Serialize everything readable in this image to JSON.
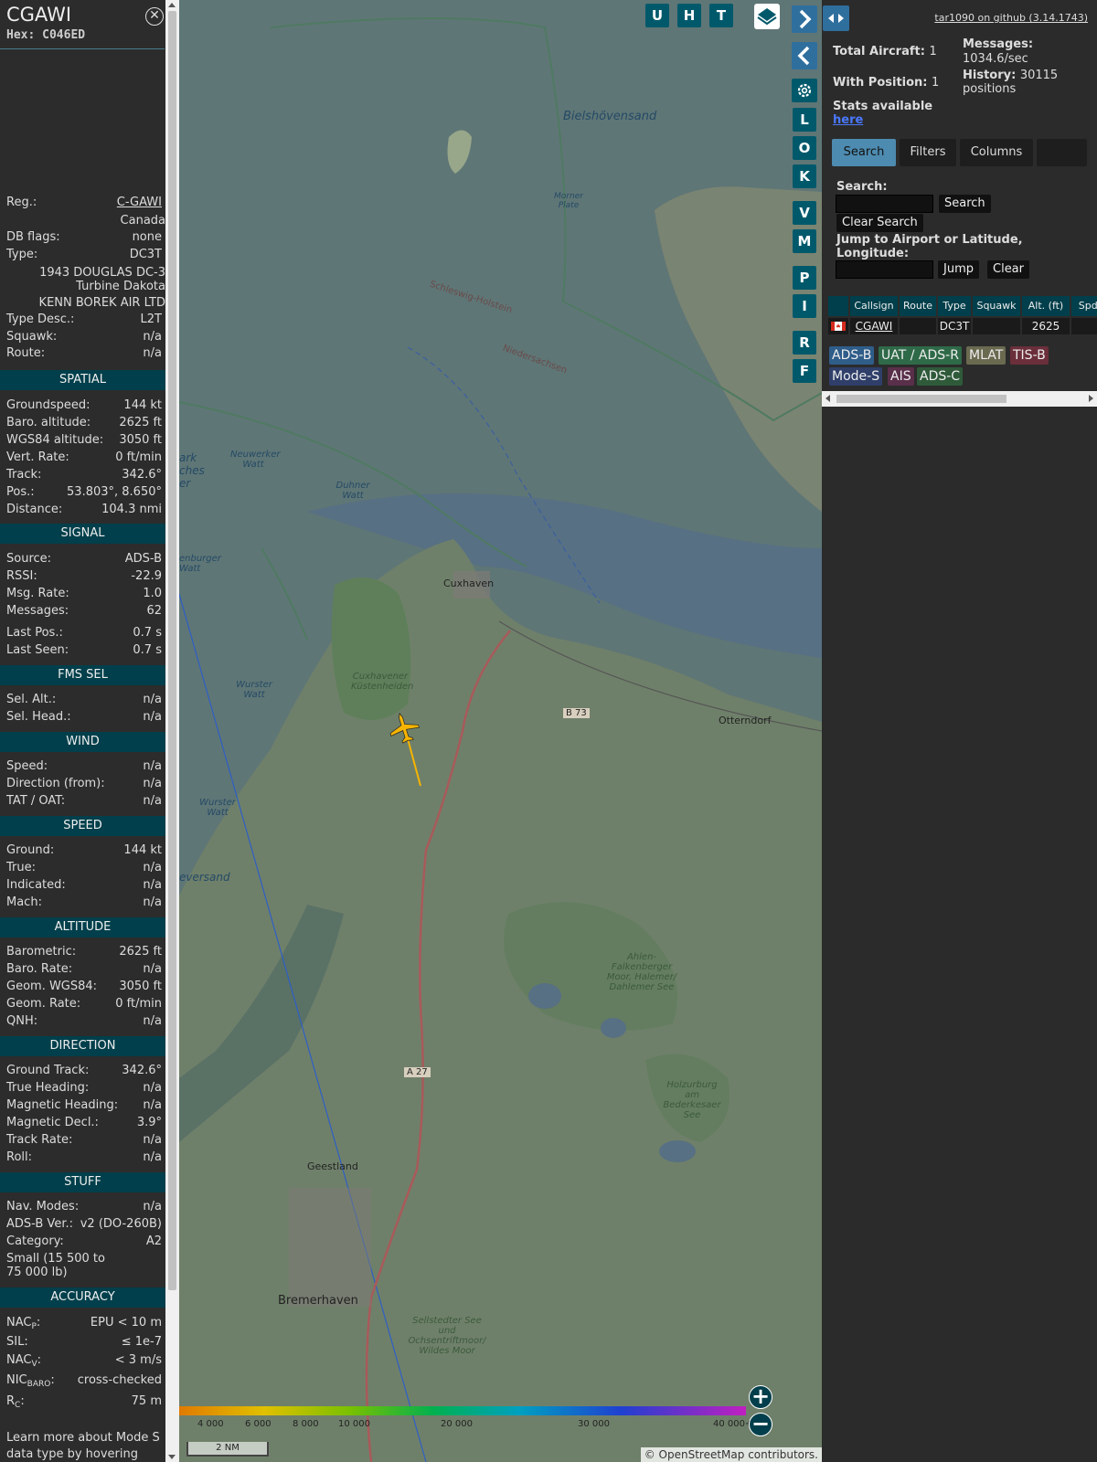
{
  "aircraft": {
    "title": "CGAWI",
    "hex": "Hex: C046ED",
    "reg_label": "Reg.:",
    "reg": "C-GAWI",
    "country": "Canada",
    "dbflags_label": "DB flags:",
    "dbflags": "none",
    "type_label": "Type:",
    "type": "DC3T",
    "type_full_1": "1943 DOUGLAS DC-3",
    "type_full_2": "Turbine Dakota",
    "operator": "KENN BOREK AIR LTD",
    "typedesc_label": "Type Desc.:",
    "typedesc": "L2T",
    "squawk_label": "Squawk:",
    "squawk": "n/a",
    "route_label": "Route:",
    "route": "n/a"
  },
  "sections": {
    "spatial": "SPATIAL",
    "signal": "SIGNAL",
    "fms": "FMS SEL",
    "wind": "WIND",
    "speed": "SPEED",
    "altitude": "ALTITUDE",
    "direction": "DIRECTION",
    "stuff": "STUFF",
    "accuracy": "ACCURACY"
  },
  "spatial": {
    "gs_label": "Groundspeed:",
    "gs": "144 kt",
    "baro_label": "Baro. altitude:",
    "baro": "2625 ft",
    "wgs_label": "WGS84 altitude:",
    "wgs": "3050 ft",
    "vr_label": "Vert. Rate:",
    "vr": "0 ft/min",
    "track_label": "Track:",
    "track": "342.6°",
    "pos_label": "Pos.:",
    "pos": "53.803°, 8.650°",
    "dist_label": "Distance:",
    "dist": "104.3 nmi"
  },
  "signal": {
    "src_label": "Source:",
    "src": "ADS-B",
    "rssi_label": "RSSI:",
    "rssi": "-22.9",
    "rate_label": "Msg. Rate:",
    "rate": "1.0",
    "msgs_label": "Messages:",
    "msgs": "62",
    "lastpos_label": "Last Pos.:",
    "lastpos": "0.7 s",
    "lastseen_label": "Last Seen:",
    "lastseen": "0.7 s"
  },
  "fms": {
    "alt_label": "Sel. Alt.:",
    "alt": "n/a",
    "head_label": "Sel. Head.:",
    "head": "n/a"
  },
  "wind": {
    "speed_label": "Speed:",
    "speed": "n/a",
    "dir_label": "Direction (from):",
    "dir": "n/a",
    "tat_label": "TAT / OAT:",
    "tat": "n/a"
  },
  "speed": {
    "ground_label": "Ground:",
    "ground": "144 kt",
    "true_label": "True:",
    "true": "n/a",
    "ind_label": "Indicated:",
    "ind": "n/a",
    "mach_label": "Mach:",
    "mach": "n/a"
  },
  "altitude": {
    "baro_label": "Barometric:",
    "baro": "2625 ft",
    "brate_label": "Baro. Rate:",
    "brate": "n/a",
    "geom_label": "Geom. WGS84:",
    "geom": "3050 ft",
    "grate_label": "Geom. Rate:",
    "grate": "0 ft/min",
    "qnh_label": "QNH:",
    "qnh": "n/a"
  },
  "direction": {
    "gt_label": "Ground Track:",
    "gt": "342.6°",
    "th_label": "True Heading:",
    "th": "n/a",
    "mh_label": "Magnetic Heading:",
    "mh": "n/a",
    "md_label": "Magnetic Decl.:",
    "md": "3.9°",
    "tr_label": "Track Rate:",
    "tr": "n/a",
    "roll_label": "Roll:",
    "roll": "n/a"
  },
  "stuff": {
    "nav_label": "Nav. Modes:",
    "nav": "n/a",
    "adsb_label": "ADS-B Ver.:",
    "adsb": "v2 (DO-260B)",
    "cat_label": "Category:",
    "cat": "A2",
    "cat_desc_1": "Small (15 500 to",
    "cat_desc_2": "75 000 lb)"
  },
  "accuracy": {
    "nacp_label": "NAC",
    "nacp_sub": "P",
    "nacp": "EPU < 10 m",
    "sil_label": "SIL:",
    "sil": "≤ 1e-7",
    "nacv_label": "NAC",
    "nacv_sub": "V",
    "nacv": "< 3 m/s",
    "nic_label": "NIC",
    "nic_sub": "BARO",
    "nic": "cross-checked",
    "rc_label": "R",
    "rc_sub": "C",
    "rc": "75 m"
  },
  "footer_1": "Learn more about Mode S",
  "footer_2": "data type by hovering over",
  "map": {
    "buttons": [
      "U",
      "H",
      "T",
      "L",
      "O",
      "K",
      "V",
      "M",
      "P",
      "I",
      "R",
      "F"
    ],
    "labels": {
      "bielshoven": "Bielshövensand",
      "cuxhaven": "Cuxhaven",
      "otterndorf": "Otterndorf",
      "geestland": "Geestland",
      "bremerhaven": "Bremerhaven",
      "b73": "B 73",
      "a27": "A 27",
      "neuwerker": "Neuwerker Watt",
      "duhner": "Duhner Watt",
      "wurster1": "Wurster Watt",
      "wurster2": "Wurster Watt",
      "cuxhoven": "Cuxhavener Küstenheiden",
      "ahlen": "Ahlen-Falkenberger Moor, Halemer/ Dahlemer See",
      "holzurburg": "Holzurburg am Bederkesaer See",
      "sellstedter": "Sellstedter See und Ochsentriftmoor/ Wildes Moor",
      "morner": "Morner Plate",
      "schleswig": "Schleswig-Holstein",
      "niedersachsen": "Niedersachsen",
      "eversand": "eversand",
      "enburger": "enburger Watt",
      "ark": "ark ches er"
    },
    "alt_scale": [
      "4 000",
      "6 000",
      "8 000",
      "10 000",
      "20 000",
      "30 000",
      "40 000+"
    ],
    "scale": "2 NM",
    "attribution_prefix": "©",
    "attribution_link": "OpenStreetMap",
    "attribution_suffix": "contributors."
  },
  "right": {
    "github": "tar1090 on github (3.14.1743)",
    "total_label": "Total Aircraft:",
    "total": "1",
    "withpos_label": "With Position:",
    "withpos": "1",
    "messages_label": "Messages:",
    "messages": "1034.6/sec",
    "history_label": "History:",
    "history": "30115",
    "history_unit": "positions",
    "stats_label": "Stats available",
    "stats_link": "here",
    "tabs": [
      "Search",
      "Filters",
      "Columns"
    ],
    "search_label": "Search:",
    "search_btn": "Search",
    "clear_search": "Clear Search",
    "jump_label": "Jump to Airport or Latitude, Longitude:",
    "jump_btn": "Jump",
    "clear_btn": "Clear",
    "table_headers": [
      "Callsign",
      "Route",
      "Type",
      "Squawk",
      "Alt. (ft)",
      "Spd."
    ],
    "table_row": {
      "callsign": "CGAWI",
      "route": "",
      "type": "DC3T",
      "squawk": "",
      "alt": "2625",
      "spd": ""
    },
    "badges": [
      "ADS-B",
      "UAT / ADS-R",
      "MLAT",
      "TIS-B",
      "Mode-S",
      "AIS",
      "ADS-C"
    ]
  },
  "colors": {
    "section_bg": "#003f4b",
    "button_bg": "#00596b",
    "active_tab": "#4d8bb0",
    "track": "#f5b400"
  }
}
